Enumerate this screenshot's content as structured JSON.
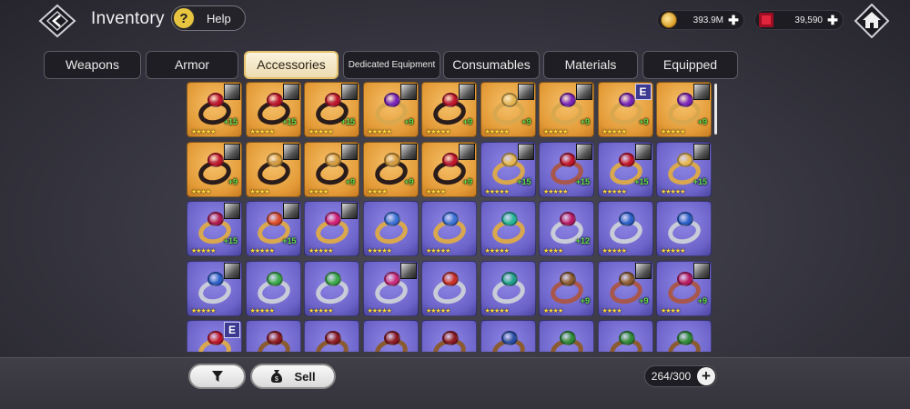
{
  "header": {
    "title": "Inventory",
    "help_label": "Help",
    "gold_value": "393.9M",
    "gem_value": "39,590"
  },
  "tabs": [
    {
      "label": "Weapons",
      "active": false
    },
    {
      "label": "Armor",
      "active": false
    },
    {
      "label": "Accessories",
      "active": true
    },
    {
      "label": "Dedicated Equipment",
      "active": false
    },
    {
      "label": "Consumables",
      "active": false
    },
    {
      "label": "Materials",
      "active": false
    },
    {
      "label": "Equipped",
      "active": false
    }
  ],
  "colors": {
    "orange_slot": "#e39a36",
    "purple_slot": "#6b63c8",
    "active_tab": "#f3e6c4",
    "star": "#ffd93a",
    "level_text": "#62e24a"
  },
  "items": [
    {
      "bg": "orange",
      "ring": "dark",
      "gem": "#c0152b",
      "stars": 5,
      "level": "+15",
      "badge": "portrait"
    },
    {
      "bg": "orange",
      "ring": "dark",
      "gem": "#c0152b",
      "stars": 5,
      "level": "+15",
      "badge": "portrait"
    },
    {
      "bg": "orange",
      "ring": "dark",
      "gem": "#c0152b",
      "stars": 5,
      "level": "+15",
      "badge": "portrait"
    },
    {
      "bg": "orange",
      "ring": "gold",
      "gem": "#7a24b8",
      "stars": 5,
      "level": "+9",
      "badge": "portrait"
    },
    {
      "bg": "orange",
      "ring": "dark",
      "gem": "#c0152b",
      "stars": 5,
      "level": "+9",
      "badge": "portrait"
    },
    {
      "bg": "orange",
      "ring": "gold",
      "gem": "#e3b451",
      "stars": 5,
      "level": "+9",
      "badge": "portrait"
    },
    {
      "bg": "orange",
      "ring": "gold",
      "gem": "#7a24b8",
      "stars": 5,
      "level": "+9",
      "badge": "portrait"
    },
    {
      "bg": "orange",
      "ring": "gold",
      "gem": "#7a24b8",
      "stars": 5,
      "level": "+9",
      "badge": "E"
    },
    {
      "bg": "orange",
      "ring": "gold",
      "gem": "#7a24b8",
      "stars": 5,
      "level": "+9",
      "badge": "portrait"
    },
    {
      "bg": "orange",
      "ring": "dark",
      "gem": "#c0152b",
      "stars": 4,
      "level": "+9",
      "badge": "portrait"
    },
    {
      "bg": "orange",
      "ring": "dark",
      "gem": "#d59a3b",
      "stars": 4,
      "level": "",
      "badge": "portrait"
    },
    {
      "bg": "orange",
      "ring": "dark",
      "gem": "#d59a3b",
      "stars": 4,
      "level": "+9",
      "badge": "portrait"
    },
    {
      "bg": "orange",
      "ring": "dark",
      "gem": "#d59a3b",
      "stars": 4,
      "level": "+9",
      "badge": "portrait"
    },
    {
      "bg": "orange",
      "ring": "dark",
      "gem": "#c0152b",
      "stars": 4,
      "level": "+9",
      "badge": "portrait"
    },
    {
      "bg": "purple",
      "ring": "gold",
      "gem": "#e3b451",
      "stars": 5,
      "level": "+15",
      "badge": "portrait"
    },
    {
      "bg": "purple",
      "ring": "rose",
      "gem": "#c0152b",
      "stars": 5,
      "level": "+15",
      "badge": "portrait"
    },
    {
      "bg": "purple",
      "ring": "gold",
      "gem": "#c0152b",
      "stars": 5,
      "level": "+15",
      "badge": "portrait"
    },
    {
      "bg": "purple",
      "ring": "gold",
      "gem": "#e3b451",
      "stars": 5,
      "level": "+15",
      "badge": "portrait"
    },
    {
      "bg": "purple",
      "ring": "gold",
      "gem": "#b01a50",
      "stars": 5,
      "level": "+15",
      "badge": "portrait"
    },
    {
      "bg": "purple",
      "ring": "gold",
      "gem": "#d8492b",
      "stars": 5,
      "level": "+15",
      "badge": "portrait"
    },
    {
      "bg": "purple",
      "ring": "gold",
      "gem": "#d02079",
      "stars": 5,
      "level": "",
      "badge": "portrait"
    },
    {
      "bg": "purple",
      "ring": "gold",
      "gem": "#3a72d8",
      "stars": 5,
      "level": "",
      "badge": ""
    },
    {
      "bg": "purple",
      "ring": "gold",
      "gem": "#3a72d8",
      "stars": 5,
      "level": "",
      "badge": ""
    },
    {
      "bg": "purple",
      "ring": "gold",
      "gem": "#25b59a",
      "stars": 5,
      "level": "",
      "badge": ""
    },
    {
      "bg": "purple",
      "ring": "silver",
      "gem": "#b81a66",
      "stars": 4,
      "level": "+12",
      "badge": ""
    },
    {
      "bg": "purple",
      "ring": "silver",
      "gem": "#2a5fc8",
      "stars": 5,
      "level": "",
      "badge": ""
    },
    {
      "bg": "purple",
      "ring": "silver",
      "gem": "#2a5fc8",
      "stars": 5,
      "level": "",
      "badge": ""
    },
    {
      "bg": "purple",
      "ring": "silver",
      "gem": "#2a5fc8",
      "stars": 5,
      "level": "",
      "badge": "portrait"
    },
    {
      "bg": "purple",
      "ring": "silver",
      "gem": "#3aa84a",
      "stars": 5,
      "level": "",
      "badge": ""
    },
    {
      "bg": "purple",
      "ring": "silver",
      "gem": "#3aa84a",
      "stars": 5,
      "level": "",
      "badge": ""
    },
    {
      "bg": "purple",
      "ring": "silver",
      "gem": "#c82a7a",
      "stars": 5,
      "level": "",
      "badge": "portrait"
    },
    {
      "bg": "purple",
      "ring": "silver",
      "gem": "#c8302a",
      "stars": 5,
      "level": "",
      "badge": ""
    },
    {
      "bg": "purple",
      "ring": "silver",
      "gem": "#1f9e8a",
      "stars": 5,
      "level": "",
      "badge": ""
    },
    {
      "bg": "purple",
      "ring": "rose",
      "gem": "#8a5b30",
      "stars": 4,
      "level": "+9",
      "badge": ""
    },
    {
      "bg": "purple",
      "ring": "rose",
      "gem": "#8a5b30",
      "stars": 4,
      "level": "+9",
      "badge": "portrait"
    },
    {
      "bg": "purple",
      "ring": "rose",
      "gem": "#b81a66",
      "stars": 4,
      "level": "+9",
      "badge": "portrait"
    },
    {
      "bg": "purple",
      "ring": "gold",
      "gem": "#c0152b",
      "stars": 4,
      "level": "",
      "badge": "E"
    },
    {
      "bg": "purple",
      "ring": "bronze",
      "gem": "#8c1a24",
      "stars": 4,
      "level": "",
      "badge": ""
    },
    {
      "bg": "purple",
      "ring": "bronze",
      "gem": "#8c1a24",
      "stars": 4,
      "level": "",
      "badge": ""
    },
    {
      "bg": "purple",
      "ring": "bronze",
      "gem": "#8c1a24",
      "stars": 4,
      "level": "",
      "badge": ""
    },
    {
      "bg": "purple",
      "ring": "bronze",
      "gem": "#8c1a24",
      "stars": 4,
      "level": "",
      "badge": ""
    },
    {
      "bg": "purple",
      "ring": "bronze",
      "gem": "#2a4fa8",
      "stars": 4,
      "level": "",
      "badge": ""
    },
    {
      "bg": "purple",
      "ring": "bronze",
      "gem": "#2e8a3a",
      "stars": 4,
      "level": "",
      "badge": ""
    },
    {
      "bg": "purple",
      "ring": "bronze",
      "gem": "#2e8a3a",
      "stars": 4,
      "level": "",
      "badge": ""
    },
    {
      "bg": "purple",
      "ring": "bronze",
      "gem": "#2e8a3a",
      "stars": 4,
      "level": "",
      "badge": ""
    }
  ],
  "footer": {
    "sell_label": "Sell",
    "capacity": "264/300"
  }
}
